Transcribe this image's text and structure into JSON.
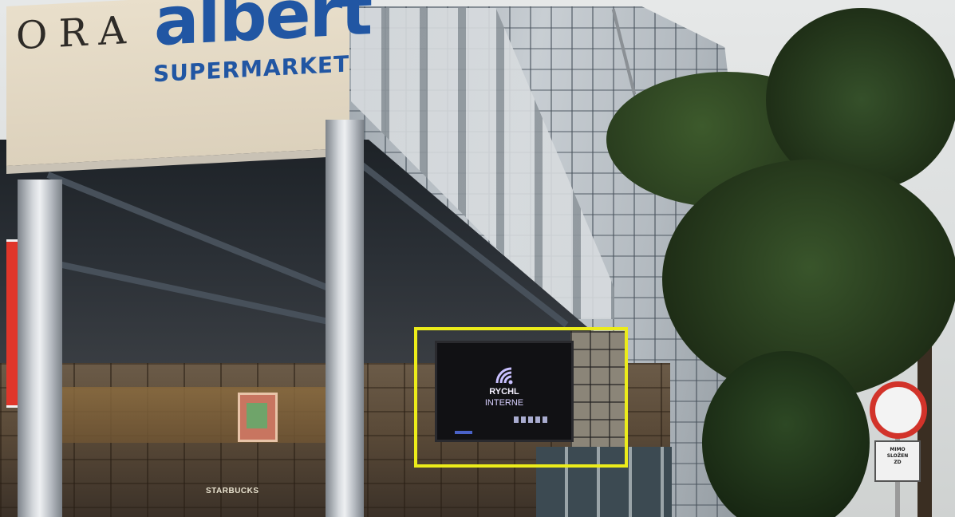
{
  "scene": {
    "description_label": "photo"
  },
  "sign": {
    "partial_word": "ORA",
    "brand": "albert",
    "subtitle": "SUPERMARKET"
  },
  "billboard": {
    "line1": "RYCHL",
    "line2": "INTERNE"
  },
  "store": {
    "starbucks_text": "STARBUCKS"
  },
  "road_sign": {
    "plate_lines": [
      "MIMO",
      "SLOŽEN",
      "ZD"
    ]
  },
  "colors": {
    "brand_blue": "#2156a3",
    "highlight_yellow": "#ecec1a",
    "sign_red": "#d2332a"
  }
}
